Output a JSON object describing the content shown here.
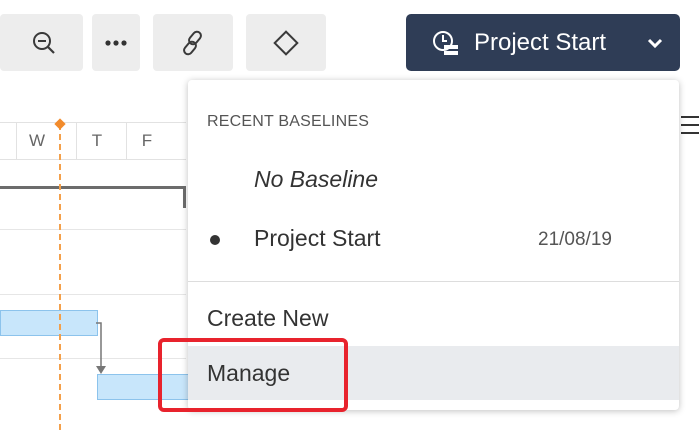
{
  "toolbar": {
    "zoom_out_icon": "zoom-out-icon",
    "more_icon": "more-horizontal-icon",
    "link_icon": "link-icon",
    "diamond_icon": "milestone-diamond-icon",
    "baseline_button": {
      "label": "Project Start",
      "icon": "baseline-clock-icon",
      "chevron": "chevron-down-icon"
    }
  },
  "gantt": {
    "days": [
      "W",
      "T",
      "F"
    ],
    "today_color": "#f28b2c",
    "task_color": "#c8e6fb"
  },
  "dropdown": {
    "heading": "RECENT BASELINES",
    "no_baseline": "No Baseline",
    "baselines": [
      {
        "name": "Project Start",
        "date": "21/08/19",
        "selected": true
      }
    ],
    "create_new": "Create New",
    "manage": "Manage"
  },
  "colors": {
    "primary": "#2f3d56",
    "highlight": "#e8232d",
    "hover": "#e9ebee"
  }
}
